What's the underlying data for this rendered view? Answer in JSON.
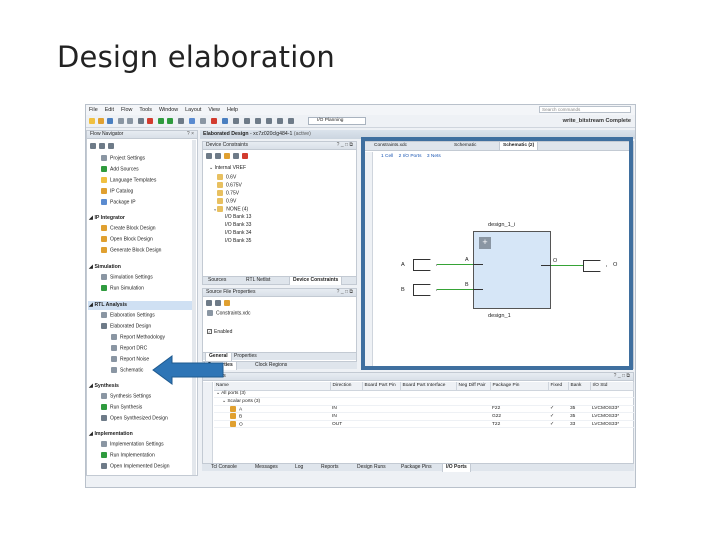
{
  "slide": {
    "title": "Design elaboration"
  },
  "menu": [
    "File",
    "Edit",
    "Flow",
    "Tools",
    "Window",
    "Layout",
    "View",
    "Help"
  ],
  "search": {
    "placeholder": "Search commands"
  },
  "toolbar": {
    "layout_select": "I/O Planning",
    "status": "write_bitstream Complete"
  },
  "flow_navigator": {
    "title": "Flow Navigator",
    "project_manager": [
      "Project Settings",
      "Add Sources",
      "Language Templates",
      "IP Catalog",
      "Package IP"
    ],
    "ip_integrator": {
      "label": "IP Integrator",
      "items": [
        "Create Block Design",
        "Open Block Design",
        "Generate Block Design"
      ]
    },
    "simulation": {
      "label": "Simulation",
      "items": [
        "Simulation Settings",
        "Run Simulation"
      ]
    },
    "rtl_analysis": {
      "label": "RTL Analysis",
      "items": [
        "Elaboration Settings",
        "Elaborated Design"
      ],
      "subitems": [
        "Report Methodology",
        "Report DRC",
        "Report Noise",
        "Schematic"
      ]
    },
    "synthesis": {
      "label": "Synthesis",
      "items": [
        "Synthesis Settings",
        "Run Synthesis",
        "Open Synthesized Design"
      ]
    },
    "implementation": {
      "label": "Implementation",
      "items": [
        "Implementation Settings",
        "Run Implementation",
        "Open Implemented Design"
      ]
    }
  },
  "elaborated": {
    "label": "Elaborated Design",
    "part": "xc7z020clg484-1",
    "state": "(active)"
  },
  "device_constraints": {
    "title": "Device Constraints",
    "root": "Internal VREF",
    "items": [
      "0.6V",
      "0.675V",
      "0.75V",
      "0.9V",
      "NONE (4)"
    ],
    "banks": [
      "I/O Bank 13",
      "I/O Bank 33",
      "I/O Bank 34",
      "I/O Bank 35"
    ],
    "tabs": [
      "Sources",
      "RTL Netlist",
      "Device Constraints"
    ]
  },
  "source_props": {
    "title": "Source File Properties",
    "file": "Constraints.xdc",
    "enabled": "Enabled",
    "tabs": [
      "General",
      "Properties"
    ]
  },
  "bottom_left_tabs": [
    "Properties",
    "Clock Regions"
  ],
  "schematic": {
    "tabs": [
      "Constraints.xdc",
      "Schematic",
      "Schematic (2)"
    ],
    "stats": [
      "1 Cell",
      "2 I/O Ports",
      "3 Nets"
    ],
    "cell_name": "design_1_i",
    "cell_type": "design_1",
    "in_port": "A",
    "in_port2": "B",
    "pin_a": "A",
    "pin_b": "B",
    "pin_o": "O",
    "out_port": "O",
    "plus": "+"
  },
  "io_ports": {
    "title": "I/O Ports",
    "columns": [
      "Name",
      "Direction",
      "Board Part Pin",
      "Board Part Interface",
      "Neg Diff Pair",
      "Package Pin",
      "Fixed",
      "Bank",
      "I/O Std"
    ],
    "groups": [
      "All ports (3)",
      "Scalar ports (3)"
    ],
    "rows": [
      {
        "name": "A",
        "dir": "IN",
        "pin": "F22",
        "bank": "35",
        "std": "LVCMOS33*"
      },
      {
        "name": "B",
        "dir": "IN",
        "pin": "G22",
        "bank": "35",
        "std": "LVCMOS33*"
      },
      {
        "name": "O",
        "dir": "OUT",
        "pin": "T22",
        "bank": "33",
        "std": "LVCMOS33*"
      }
    ]
  },
  "bottom_tabs": [
    "Tcl Console",
    "Messages",
    "Log",
    "Reports",
    "Design Runs",
    "Package Pins",
    "I/O Ports"
  ],
  "colors": {
    "frame": "#3f6f9f",
    "arrow": "#2e75b6",
    "cell_fill": "#d6e6f7",
    "wire": "#36a336"
  }
}
